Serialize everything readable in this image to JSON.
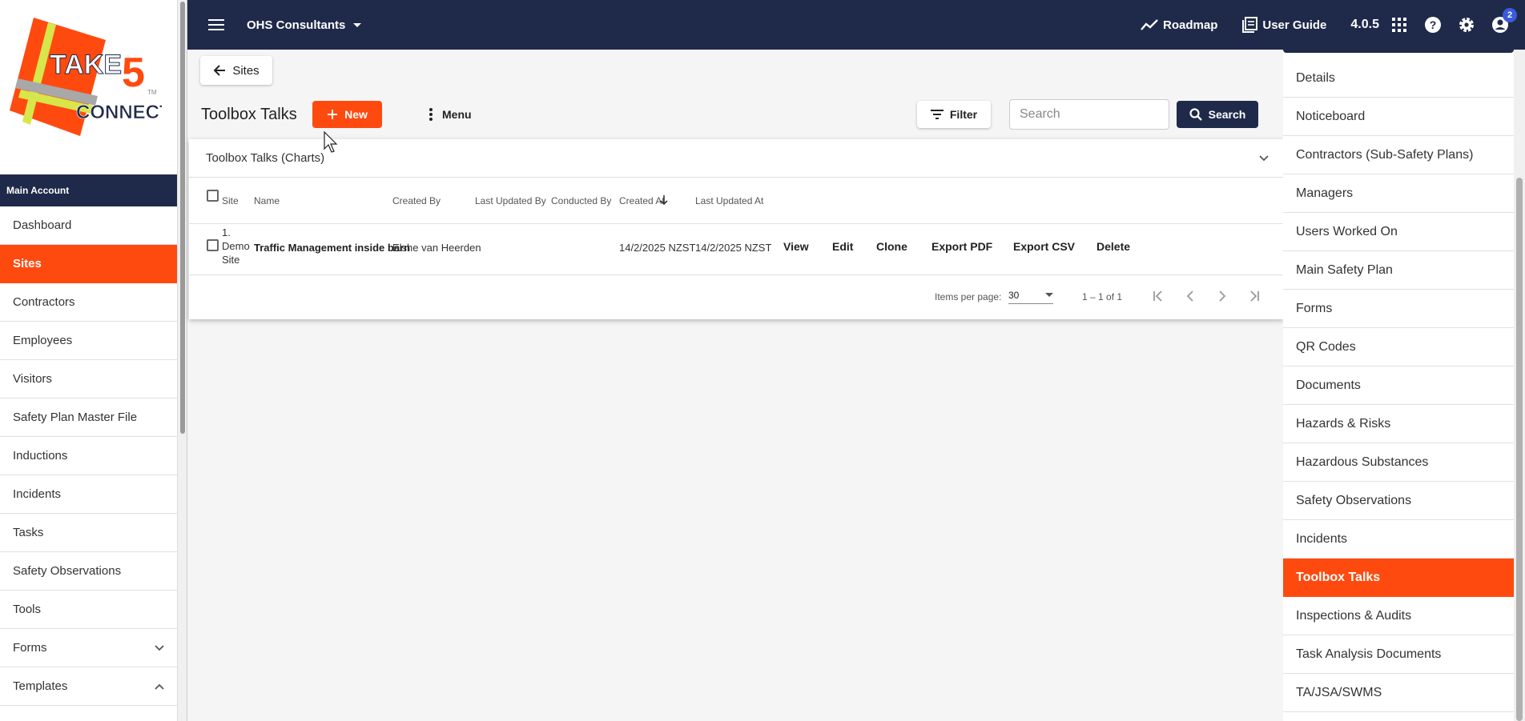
{
  "brand": {
    "logo_word1": "TAKE",
    "logo_number": "5",
    "logo_word2": "CONNECT",
    "logo_tm": "TM"
  },
  "colors": {
    "navy": "#1f2a4a",
    "accent": "#ff4a0f",
    "badge": "#3b5bdb"
  },
  "sidebar": {
    "account_label": "Main Account",
    "items": [
      {
        "label": "Dashboard",
        "active": false
      },
      {
        "label": "Sites",
        "active": true
      },
      {
        "label": "Contractors",
        "active": false
      },
      {
        "label": "Employees",
        "active": false
      },
      {
        "label": "Visitors",
        "active": false
      },
      {
        "label": "Safety Plan Master File",
        "active": false
      },
      {
        "label": "Inductions",
        "active": false
      },
      {
        "label": "Incidents",
        "active": false
      },
      {
        "label": "Tasks",
        "active": false
      },
      {
        "label": "Safety Observations",
        "active": false
      },
      {
        "label": "Tools",
        "active": false
      },
      {
        "label": "Forms",
        "active": false,
        "icon": "chevron-down-icon"
      },
      {
        "label": "Templates",
        "active": false,
        "icon": "chevron-up-icon"
      }
    ]
  },
  "topbar": {
    "org_name": "OHS Consultants",
    "roadmap_label": "Roadmap",
    "user_guide_label": "User Guide",
    "version": "4.0.5",
    "notification_count": "2",
    "icons": [
      "menu-icon",
      "roadmap-icon",
      "book-icon",
      "apps-grid-icon",
      "help-icon",
      "settings-icon",
      "account-icon"
    ]
  },
  "page": {
    "back_label": "Sites",
    "title": "Toolbox Talks",
    "new_label": "New",
    "menu_label": "Menu",
    "filter_label": "Filter",
    "search_placeholder": "Search",
    "search_button": "Search",
    "charts_label": "Toolbox Talks (Charts)"
  },
  "table": {
    "headers": {
      "site": "Site",
      "name": "Name",
      "created_by": "Created By",
      "last_updated_by": "Last Updated By",
      "conducted_by": "Conducted By",
      "created_at": "Created At",
      "last_updated_at": "Last Updated At"
    },
    "rows": [
      {
        "site_line1": "1.",
        "site_line2": "Demo",
        "site_line3": "Site",
        "name": "Traffic Management inside barn",
        "created_by": "Elshe van Heerden",
        "last_updated_by": "",
        "conducted_by": "",
        "created_at": "14/2/2025 NZST",
        "last_updated_at": "14/2/2025 NZST",
        "actions": {
          "view": "View",
          "edit": "Edit",
          "clone": "Clone",
          "export_pdf": "Export PDF",
          "export_csv": "Export CSV",
          "delete": "Delete"
        }
      }
    ]
  },
  "paginator": {
    "items_per_page_label": "Items per page:",
    "page_size": "30",
    "range": "1 – 1 of 1"
  },
  "right_panel": {
    "items": [
      {
        "label": "Details",
        "active": false
      },
      {
        "label": "Noticeboard",
        "active": false
      },
      {
        "label": "Contractors (Sub-Safety Plans)",
        "active": false
      },
      {
        "label": "Managers",
        "active": false
      },
      {
        "label": "Users Worked On",
        "active": false
      },
      {
        "label": "Main Safety Plan",
        "active": false
      },
      {
        "label": "Forms",
        "active": false
      },
      {
        "label": "QR Codes",
        "active": false
      },
      {
        "label": "Documents",
        "active": false
      },
      {
        "label": "Hazards & Risks",
        "active": false
      },
      {
        "label": "Hazardous Substances",
        "active": false
      },
      {
        "label": "Safety Observations",
        "active": false
      },
      {
        "label": "Incidents",
        "active": false
      },
      {
        "label": "Toolbox Talks",
        "active": true
      },
      {
        "label": "Inspections & Audits",
        "active": false
      },
      {
        "label": "Task Analysis Documents",
        "active": false
      },
      {
        "label": "TA/JSA/SWMS",
        "active": false
      }
    ]
  }
}
